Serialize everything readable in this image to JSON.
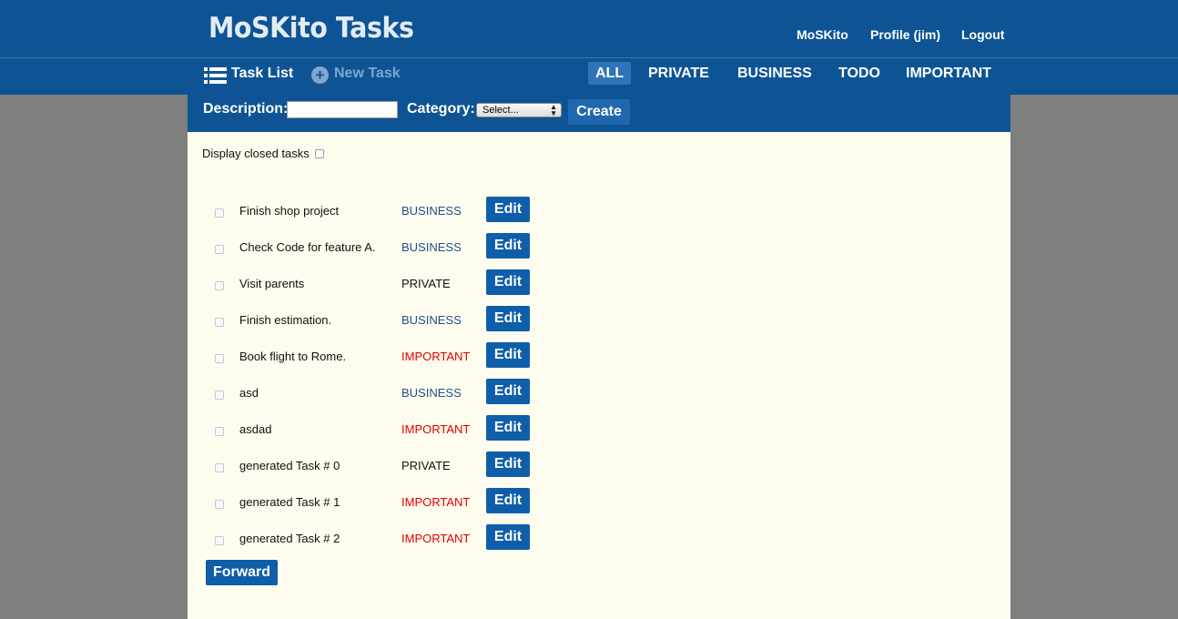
{
  "app": {
    "title": "MoSKito Tasks"
  },
  "header": {
    "links": [
      "MoSKito",
      "Profile (jim)",
      "Logout"
    ]
  },
  "nav": {
    "task_list_label": "Task List",
    "new_task_label": "New Task",
    "filters": [
      "ALL",
      "PRIVATE",
      "BUSINESS",
      "TODO",
      "IMPORTANT"
    ],
    "active_filter": "ALL"
  },
  "create_form": {
    "description_label": "Description:",
    "description_value": "",
    "category_label": "Category:",
    "category_selected": "Select...",
    "create_label": "Create"
  },
  "list": {
    "closed_toggle_label": "Display closed tasks",
    "edit_label": "Edit",
    "tasks": [
      {
        "description": "Finish shop project",
        "category": "BUSINESS"
      },
      {
        "description": "Check Code for feature A.",
        "category": "BUSINESS"
      },
      {
        "description": "Visit parents",
        "category": "PRIVATE"
      },
      {
        "description": "Finish estimation.",
        "category": "BUSINESS"
      },
      {
        "description": "Book flight to Rome.",
        "category": "IMPORTANT"
      },
      {
        "description": "asd",
        "category": "BUSINESS"
      },
      {
        "description": "asdad",
        "category": "IMPORTANT"
      },
      {
        "description": "generated Task # 0",
        "category": "PRIVATE"
      },
      {
        "description": "generated Task # 1",
        "category": "IMPORTANT"
      },
      {
        "description": "generated Task # 2",
        "category": "IMPORTANT"
      }
    ],
    "forward_label": "Forward"
  },
  "colors": {
    "brand": "#0e5494",
    "business": "#1f4f8a",
    "private": "#111111",
    "important": "#e00000"
  }
}
